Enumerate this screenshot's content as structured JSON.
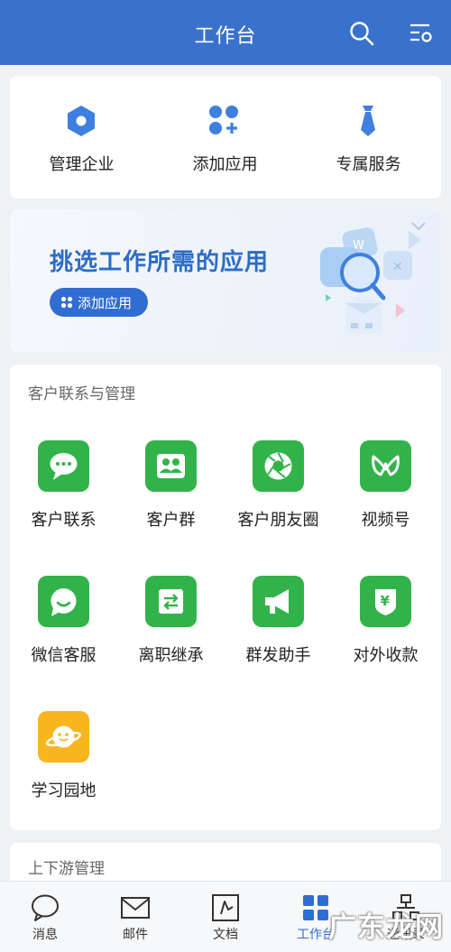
{
  "header": {
    "title": "工作台",
    "search_icon": "search-icon",
    "settings_icon": "settings-icon"
  },
  "quick_actions": [
    {
      "label": "管理企业",
      "icon": "hexagon-icon"
    },
    {
      "label": "添加应用",
      "icon": "add-app-icon"
    },
    {
      "label": "专属服务",
      "icon": "tie-icon"
    }
  ],
  "banner": {
    "title": "挑选工作所需的应用",
    "button_label": "添加应用"
  },
  "customer_section": {
    "title": "客户联系与管理",
    "apps": [
      {
        "label": "客户联系",
        "icon": "chat-bubble-icon"
      },
      {
        "label": "客户群",
        "icon": "group-icon"
      },
      {
        "label": "客户朋友圈",
        "icon": "aperture-icon"
      },
      {
        "label": "视频号",
        "icon": "video-channel-icon"
      },
      {
        "label": "微信客服",
        "icon": "service-chat-icon"
      },
      {
        "label": "离职继承",
        "icon": "transfer-icon"
      },
      {
        "label": "群发助手",
        "icon": "megaphone-icon"
      },
      {
        "label": "对外收款",
        "icon": "yuan-shield-icon"
      },
      {
        "label": "学习园地",
        "icon": "planet-icon"
      }
    ]
  },
  "next_section": {
    "title": "上下游管理"
  },
  "tabs": [
    {
      "label": "消息",
      "icon": "message-icon",
      "active": false
    },
    {
      "label": "邮件",
      "icon": "mail-icon",
      "active": false
    },
    {
      "label": "文档",
      "icon": "document-icon",
      "active": false
    },
    {
      "label": "工作台",
      "icon": "workbench-icon",
      "active": true
    },
    {
      "label": "通讯录",
      "icon": "contacts-icon",
      "active": false
    }
  ],
  "watermark": "广东龙网",
  "colors": {
    "header": "#3a72cb",
    "app_green": "#32b34a",
    "app_orange": "#f7b51e",
    "accent_blue": "#2f6dd0"
  }
}
